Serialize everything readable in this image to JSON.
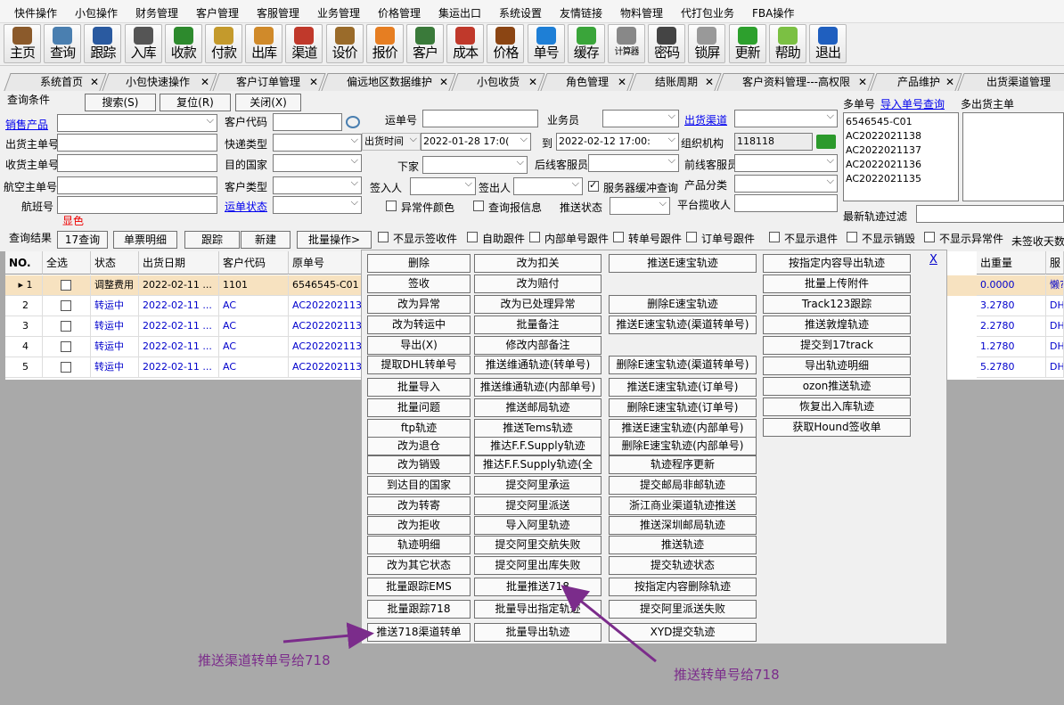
{
  "menu": [
    "快件操作",
    "小包操作",
    "财务管理",
    "客户管理",
    "客服管理",
    "业务管理",
    "价格管理",
    "集运出口",
    "系统设置",
    "友情链接",
    "物料管理",
    "代打包业务",
    "FBA操作"
  ],
  "toolbar": [
    {
      "label": "主页",
      "icon": "house-icon",
      "color": "#8b5a2b"
    },
    {
      "label": "查询",
      "icon": "magnifier-icon",
      "color": "#4a7fb0"
    },
    {
      "label": "跟踪",
      "icon": "wifi-icon",
      "color": "#2a5aa0"
    },
    {
      "label": "入库",
      "icon": "crane-icon",
      "color": "#555"
    },
    {
      "label": "收款",
      "icon": "yen-icon",
      "color": "#2d8a2d"
    },
    {
      "label": "付款",
      "icon": "hand-money-icon",
      "color": "#c49a2c"
    },
    {
      "label": "出库",
      "icon": "box-icon",
      "color": "#d08a2a"
    },
    {
      "label": "渠道",
      "icon": "network-icon",
      "color": "#c0392b"
    },
    {
      "label": "设价",
      "icon": "scale-icon",
      "color": "#9a6b2a"
    },
    {
      "label": "报价",
      "icon": "document-icon",
      "color": "#e67e22"
    },
    {
      "label": "客户",
      "icon": "users-icon",
      "color": "#3a7a3a"
    },
    {
      "label": "成本",
      "icon": "bar-chart-icon",
      "color": "#c0392b"
    },
    {
      "label": "价格",
      "icon": "tag-icon",
      "color": "#8b4513"
    },
    {
      "label": "单号",
      "icon": "eye-icon",
      "color": "#1e7fd6"
    },
    {
      "label": "缓存",
      "icon": "refresh-icon",
      "color": "#3aa53a"
    },
    {
      "label": "计算器",
      "icon": "calculator-icon",
      "color": "#888"
    },
    {
      "label": "密码",
      "icon": "camera-icon",
      "color": "#444"
    },
    {
      "label": "锁屏",
      "icon": "lock-icon",
      "color": "#999"
    },
    {
      "label": "更新",
      "icon": "download-arrow-icon",
      "color": "#2da02d"
    },
    {
      "label": "帮助",
      "icon": "help-icon",
      "color": "#7bc043"
    },
    {
      "label": "退出",
      "icon": "power-icon",
      "color": "#1f5fbf"
    }
  ],
  "tabs": [
    "系统首页",
    "小包快速操作",
    "客户订单管理",
    "偏远地区数据维护",
    "小包收货",
    "角色管理",
    "结账周期",
    "客户资料管理---高权限",
    "产品维护",
    "出货渠道管理"
  ],
  "query": {
    "title": "查询条件",
    "search_btn": "搜索(S)",
    "reset_btn": "复位(R)",
    "close_btn": "关闭(X)",
    "sales_product": "销售产品",
    "customer_code": "客户代码",
    "ship_master_no": "出货主单号",
    "express_type": "快递类型",
    "recv_master_no": "收货主单号",
    "dest_country": "目的国家",
    "air_master_no": "航空主单号",
    "customer_type": "客户类型",
    "flight_no": "航班号",
    "waybill_status": "运单状态",
    "show_color": "显色",
    "waybill_no": "运单号",
    "salesman": "业务员",
    "ship_channel": "出货渠道",
    "ship_time": "出货时间",
    "date_from": "2022-01-28 17:0(",
    "to": "到",
    "date_to": "2022-02-12 17:00:",
    "org": "组织机构",
    "org_value": "118118",
    "next_home": "下家",
    "after_cs": "后线客服员",
    "front_cs": "前线客服员",
    "signer": "签入人",
    "sign_out": "签出人",
    "server_cache": "服务器缓冲查询",
    "product_class": "产品分类",
    "abnormal_color": "异常件颜色",
    "check_report": "查single报信息",
    "push_status": "推送状态",
    "platform_pickup": "平台揽收人",
    "multi_no": "多单号",
    "import_link": "导入单号查询",
    "multi_ship": "多出货主单",
    "multi_list": [
      "6546545-C01",
      "AC2022021138",
      "AC2022021137",
      "AC2022021136",
      "AC2022021135"
    ],
    "latest_filter": "最新轨迹过滤"
  },
  "results": {
    "title": "查询结果",
    "btns": [
      "17查询",
      "单票明细",
      "跟踪",
      "新建",
      "批量操作>"
    ],
    "checks": [
      "不显示签收件",
      "自助跟件",
      "内部单号跟件",
      "转单号跟件",
      "订单号跟件",
      "不显示退件",
      "不显示销毁",
      "不显示异常件"
    ],
    "unsigned": "未签收天数"
  },
  "grid": {
    "headers": [
      "NO.",
      "全选",
      "状态",
      "出货日期",
      "客户代码",
      "原单号",
      "出重量",
      "服"
    ],
    "rows": [
      {
        "no": "1",
        "status": "调整费用",
        "date": "2022-02-11 ...",
        "cust": "1101",
        "orig": "6546545-C01",
        "weight": "0.0000",
        "svc": "懒?"
      },
      {
        "no": "2",
        "status": "转运中",
        "date": "2022-02-11 ...",
        "cust": "AC",
        "orig": "AC2022021138",
        "weight": "3.2780",
        "svc": "DHl"
      },
      {
        "no": "3",
        "status": "转运中",
        "date": "2022-02-11 ...",
        "cust": "AC",
        "orig": "AC2022021137",
        "weight": "2.2780",
        "svc": "DHl"
      },
      {
        "no": "4",
        "status": "转运中",
        "date": "2022-02-11 ...",
        "cust": "AC",
        "orig": "AC2022021136",
        "weight": "1.2780",
        "svc": "DHl"
      },
      {
        "no": "5",
        "status": "转运中",
        "date": "2022-02-11 ...",
        "cust": "AC",
        "orig": "AC2022021135",
        "weight": "5.2780",
        "svc": "DHl"
      }
    ]
  },
  "popup": {
    "close": "X",
    "col1": [
      "删除",
      "签收",
      "改为异常",
      "改为转运中",
      "导出(X)",
      "提取DHL转单号",
      "批量导入",
      "批量问题",
      "ftp轨迹",
      "改为退仓",
      "改为销毁",
      "到达目的国家",
      "改为转寄",
      "改为拒收",
      "轨迹明细",
      "改为其它状态",
      "批量跟踪EMS",
      "批量跟踪718",
      "推送718渠道转单"
    ],
    "col2": [
      "改为扣关",
      "改为赔付",
      "改为已处理异常",
      "批量备注",
      "修改内部备注",
      "推送维通轨迹(转单号)",
      "推送维通轨迹(内部单号)",
      "推送邮局轨迹",
      "推送Tems轨迹",
      "推达F.F.Supply轨迹",
      "推达F.F.Supply轨迹(全",
      "提交阿里承运",
      "提交阿里派送",
      "导入阿里轨迹",
      "提交阿里交航失败",
      "提交阿里出库失败",
      "批量推送718",
      "批量导出指定轨迹",
      "批量导出轨迹"
    ],
    "col3": [
      "推送E速宝轨迹",
      "",
      "删除E速宝轨迹",
      "推送E速宝轨迹(渠道转单号)",
      "",
      "删除E速宝轨迹(渠道转单号)",
      "推送E速宝轨迹(订单号)",
      "删除E速宝轨迹(订单号)",
      "推送E速宝轨迹(内部单号)",
      "删除E速宝轨迹(内部单号)",
      "轨迹程序更新",
      "提交邮局非邮轨迹",
      "浙江商业渠道轨迹推送",
      "推送深圳邮局轨迹",
      "推送轨迹",
      "提交轨迹状态",
      "按指定内容删除轨迹",
      "提交阿里派送失败",
      "XYD提交轨迹"
    ],
    "col4": [
      "按指定内容导出轨迹",
      "批量上传附件",
      "Track123跟踪",
      "推送敦煌轨迹",
      "提交到17track",
      "导出轨迹明细",
      "ozon推送轨迹",
      "恢复出入库轨迹",
      "获取Hound签收单"
    ]
  },
  "annotations": {
    "left": "推送渠道转单号给718",
    "right": "推送转单号给718",
    "color": "#7b2c8b"
  }
}
